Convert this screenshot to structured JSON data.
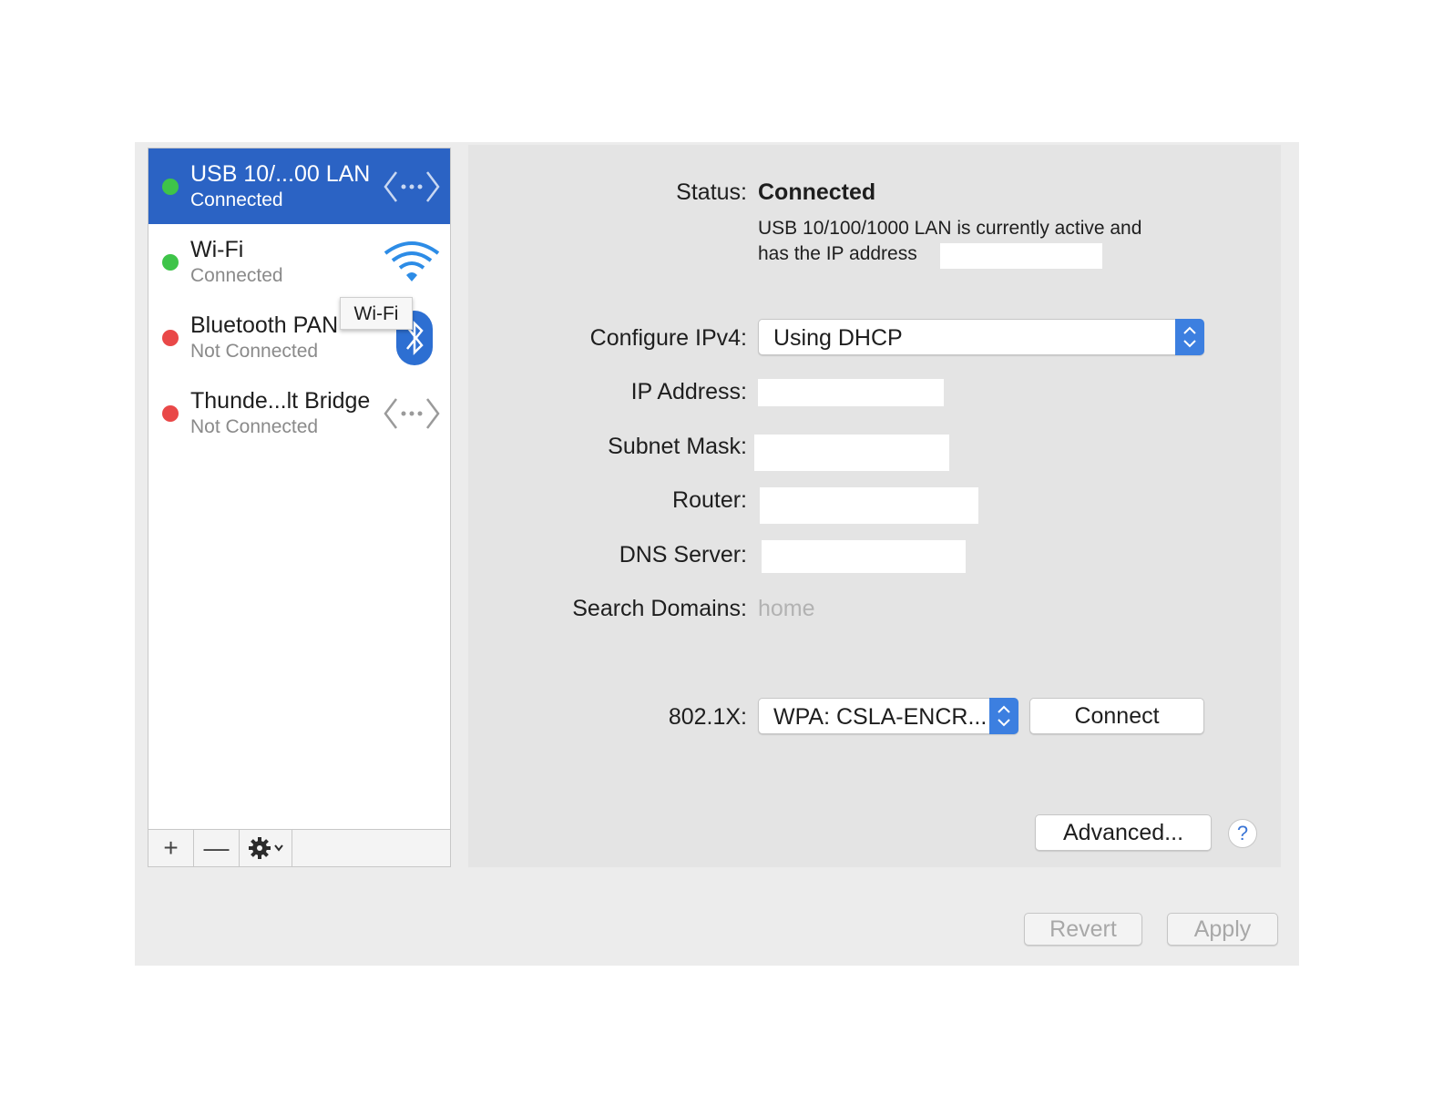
{
  "sidebar": {
    "services": [
      {
        "name": "USB 10/...00 LAN",
        "status": "Connected",
        "dot_color": "#3ec449",
        "icon": "ethernet-icon",
        "selected": true
      },
      {
        "name": "Wi-Fi",
        "status": "Connected",
        "dot_color": "#3ec449",
        "icon": "wifi-icon",
        "selected": false
      },
      {
        "name": "Bluetooth PAN",
        "status": "Not Connected",
        "dot_color": "#e94848",
        "icon": "bluetooth-icon",
        "selected": false
      },
      {
        "name": "Thunde...lt Bridge",
        "status": "Not Connected",
        "dot_color": "#e94848",
        "icon": "ethernet-icon",
        "selected": false
      }
    ],
    "tooltip": "Wi-Fi",
    "toolbar": {
      "add": "+",
      "remove": "—",
      "action": "gear-icon"
    }
  },
  "detail": {
    "status_label": "Status:",
    "status_value": "Connected",
    "status_desc_line1": "USB 10/100/1000 LAN is currently active and",
    "status_desc_line2": "has the IP address",
    "configure_label": "Configure IPv4:",
    "configure_value": "Using DHCP",
    "ip_label": "IP Address:",
    "subnet_label": "Subnet Mask:",
    "router_label": "Router:",
    "dns_label": "DNS Server:",
    "search_label": "Search Domains:",
    "search_value": "home",
    "dot1x_label": "802.1X:",
    "dot1x_value": "WPA: CSLA-ENCR...",
    "connect_button": "Connect",
    "advanced_button": "Advanced...",
    "help_button": "?"
  },
  "footer": {
    "revert_button": "Revert",
    "apply_button": "Apply"
  },
  "colors": {
    "selection": "#2b63c4",
    "accent": "#3c7fe0",
    "connected": "#3ec449",
    "not_connected": "#e94848"
  }
}
